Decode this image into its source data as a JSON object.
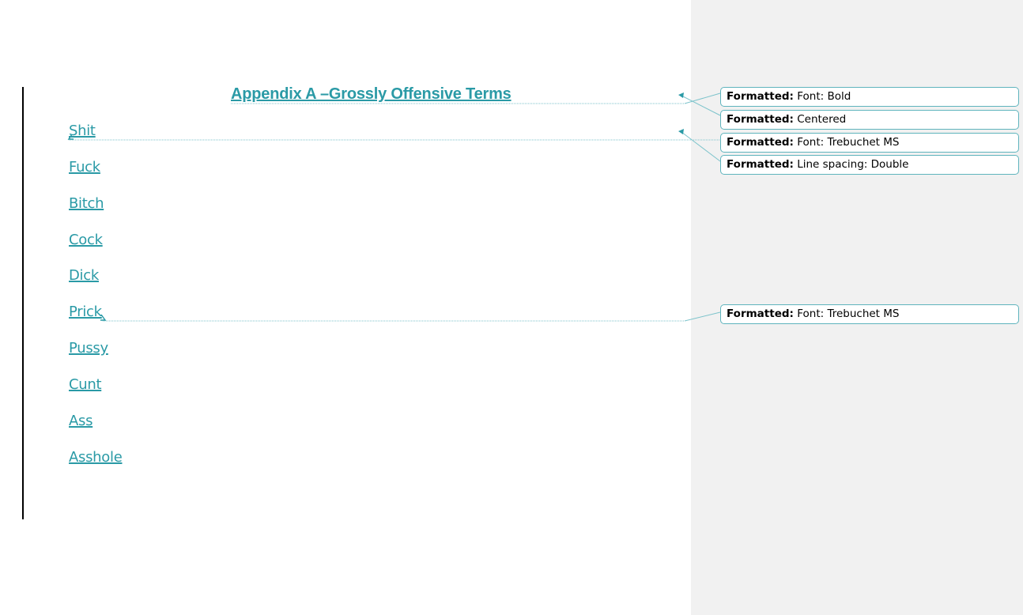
{
  "document": {
    "title": "Appendix A –Grossly Offensive Terms",
    "terms": [
      "Shit",
      "Fuck",
      "Bitch",
      "Cock",
      "Dick",
      "Prick",
      "Pussy",
      "Cunt",
      "Ass",
      "Asshole"
    ]
  },
  "comments": [
    {
      "label": "Formatted:",
      "text": " Font: Bold"
    },
    {
      "label": "Formatted:",
      "text": " Centered"
    },
    {
      "label": "Formatted:",
      "text": " Font: Trebuchet MS"
    },
    {
      "label": "Formatted:",
      "text": " Line spacing:  Double"
    },
    {
      "label": "Formatted:",
      "text": " Font: Trebuchet MS"
    }
  ],
  "colors": {
    "accent": "#2a9aa6",
    "markup_pane": "#f1f1f1",
    "balloon_border": "#5fb4bd"
  }
}
